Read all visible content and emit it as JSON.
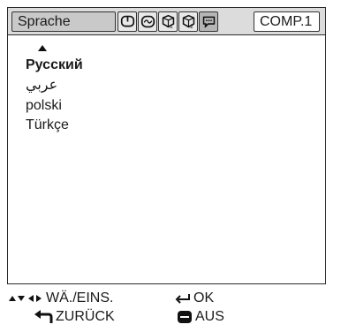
{
  "header": {
    "active_tab_label": "Sprache",
    "input_label": "COMP.1",
    "tab_icons": [
      "picture-adjust-icon",
      "signal-adjust-icon",
      "options-1-icon",
      "options-2-icon",
      "language-icon"
    ]
  },
  "language_list": {
    "items": [
      {
        "label": "Русский",
        "highlighted": true
      },
      {
        "label": "عربي",
        "highlighted": false
      },
      {
        "label": "polski",
        "highlighted": false
      },
      {
        "label": "Türkçe",
        "highlighted": false
      }
    ]
  },
  "footer": {
    "select_adjust": "WÄ./EINS.",
    "ok": "OK",
    "back": "ZURÜCK",
    "exit": "AUS"
  }
}
